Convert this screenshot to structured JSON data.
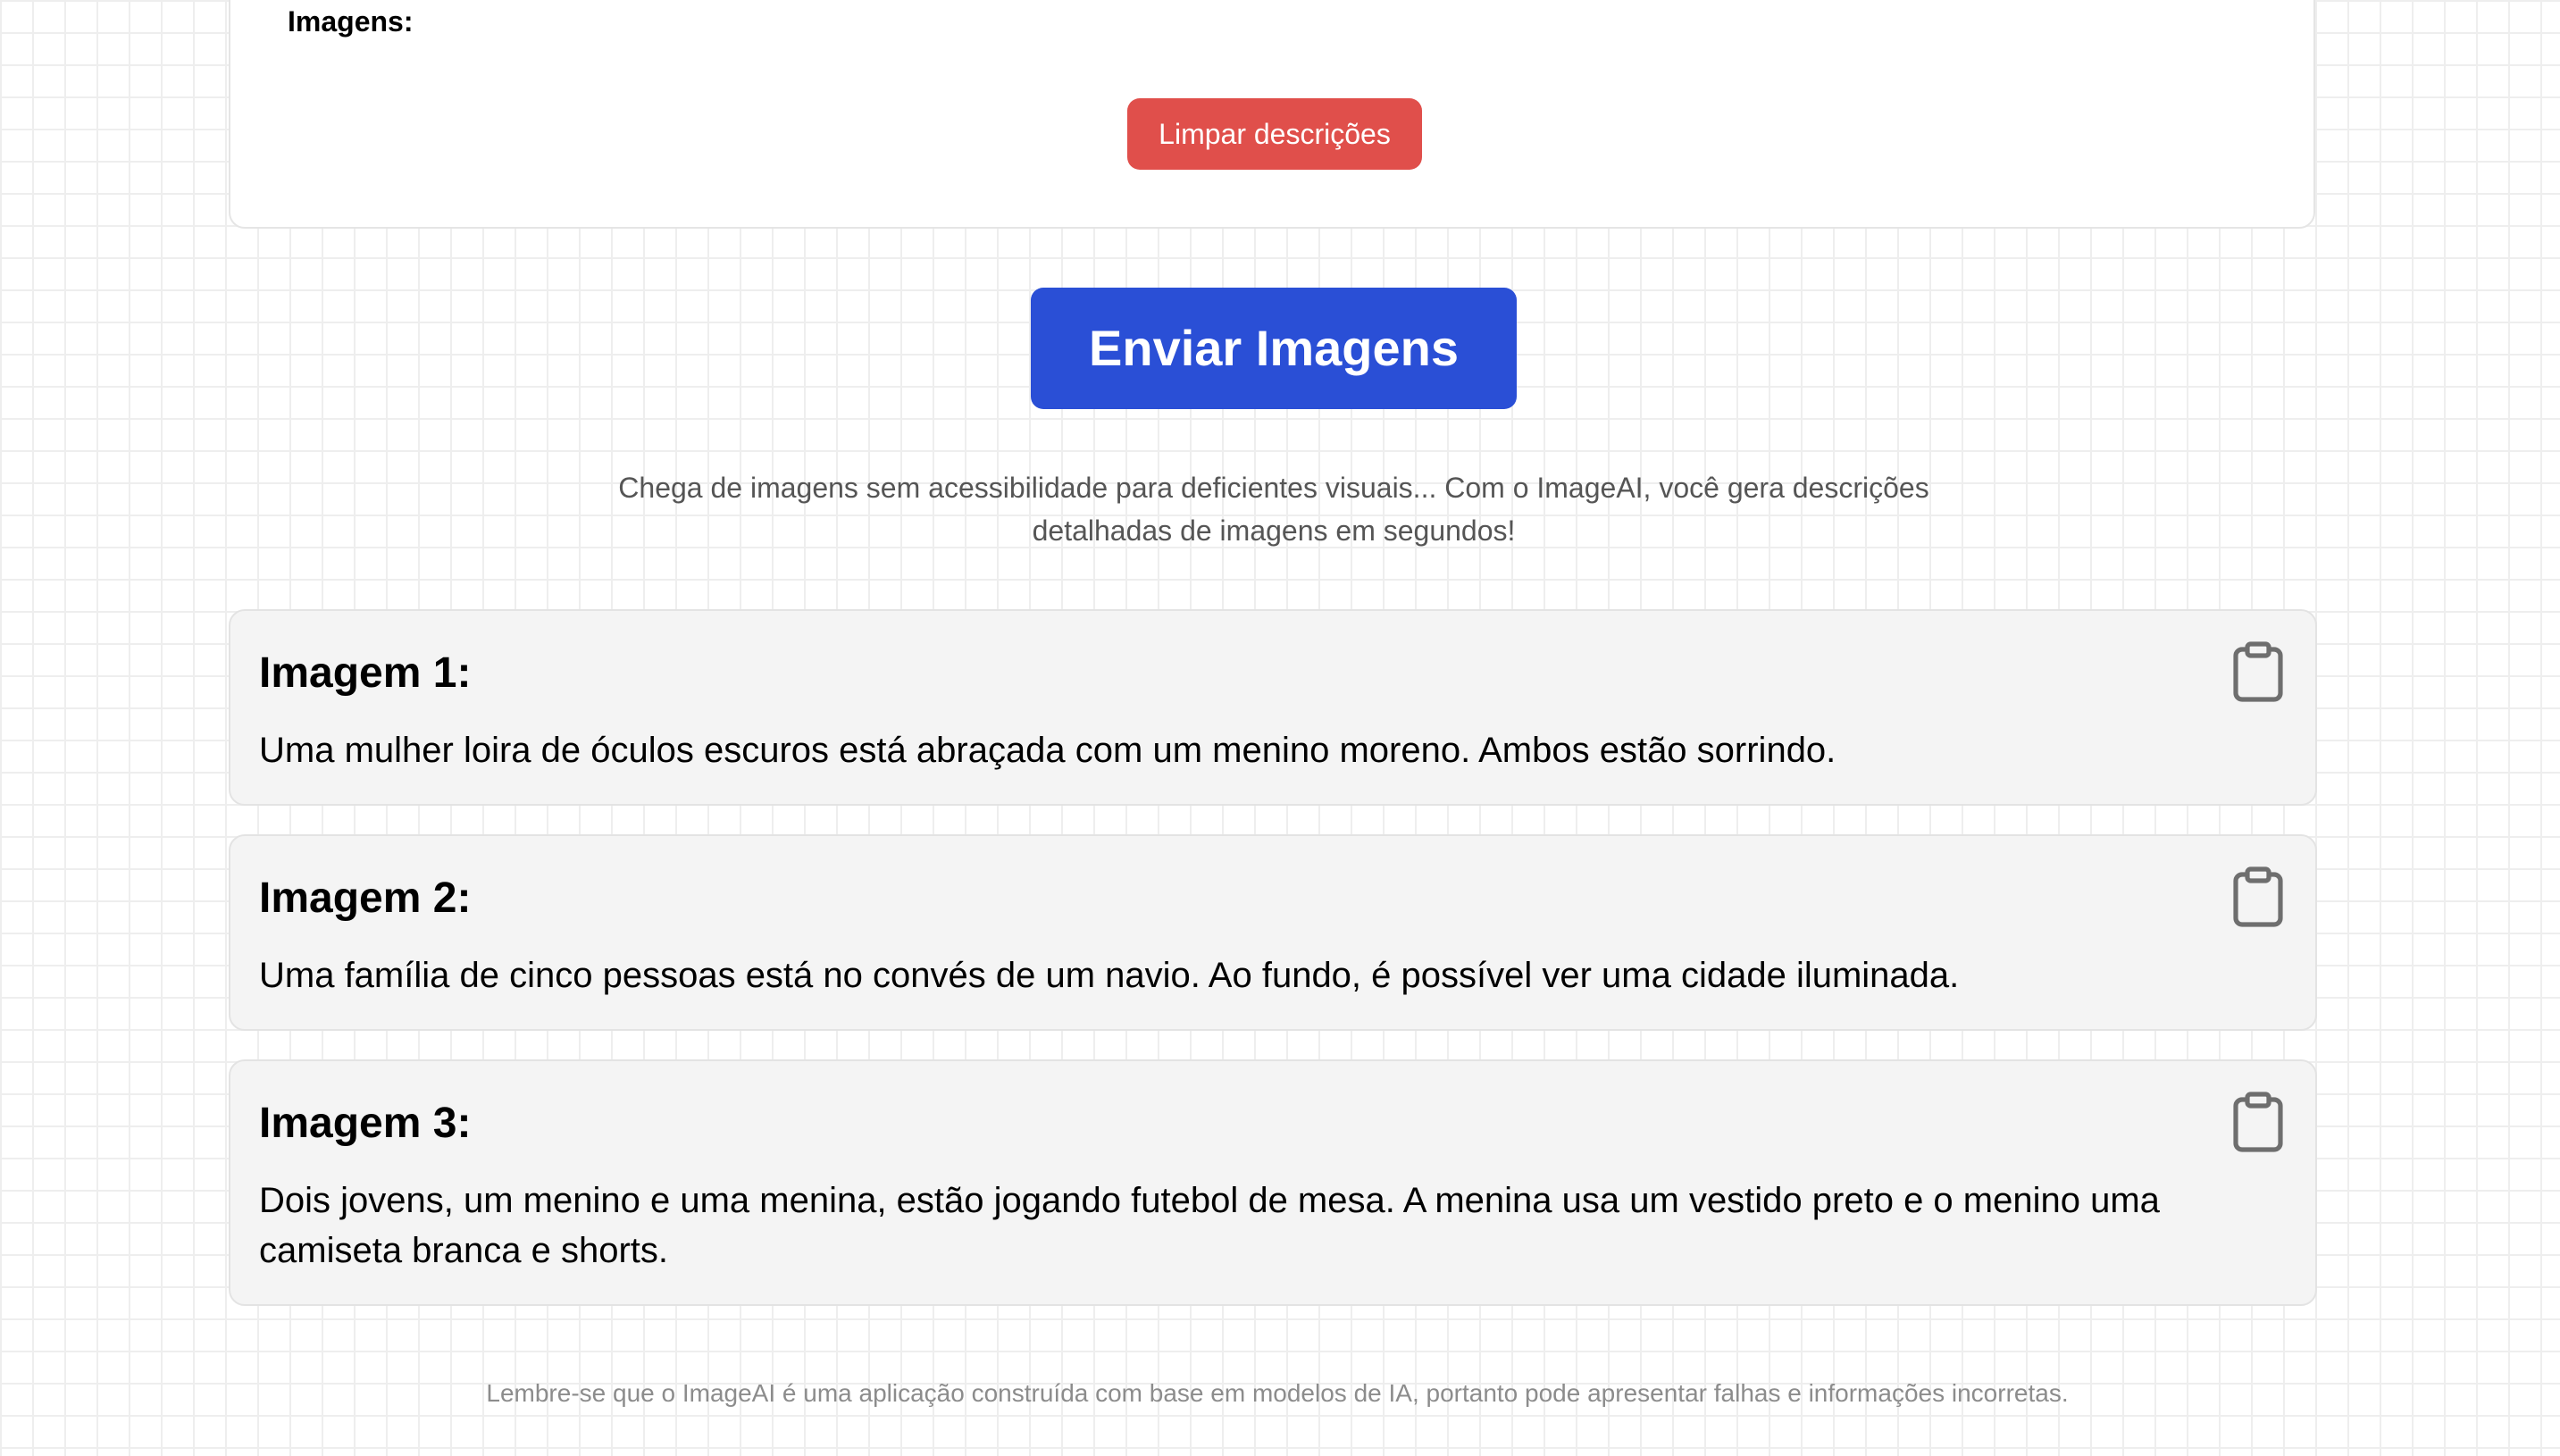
{
  "upload": {
    "images_label": "Imagens:",
    "clear_button": "Limpar descrições"
  },
  "send_button": "Enviar Imagens",
  "tagline": "Chega de imagens sem acessibilidade para deficientes visuais... Com o ImageAI, você gera descrições detalhadas de imagens em segundos!",
  "results": [
    {
      "title": "Imagem 1:",
      "description": "Uma mulher loira de óculos escuros está abraçada com um menino moreno. Ambos estão sorrindo.",
      "copy_icon": "clipboard-icon"
    },
    {
      "title": "Imagem 2:",
      "description": "Uma família de cinco pessoas está no convés de um navio. Ao fundo, é possível ver uma cidade iluminada.",
      "copy_icon": "clipboard-icon"
    },
    {
      "title": "Imagem 3:",
      "description": "Dois jovens, um menino e uma menina, estão jogando futebol de mesa. A menina usa um vestido preto e o menino uma camiseta branca e shorts.",
      "copy_icon": "clipboard-icon"
    }
  ],
  "footer": "Lembre-se que o ImageAI é uma aplicação construída com base em modelos de IA, portanto pode apresentar falhas e informações incorretas.",
  "colors": {
    "primary": "#2a4fd6",
    "danger": "#e04f4b",
    "card_background": "#f4f4f4",
    "muted_text": "#555555",
    "footer_text": "#8c8c8c"
  }
}
